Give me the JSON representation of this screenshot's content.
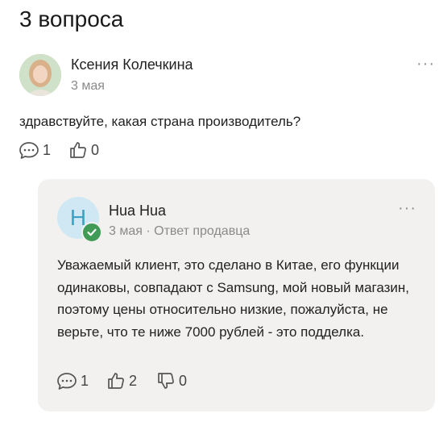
{
  "page": {
    "title": "3 вопроса"
  },
  "question": {
    "author": "Ксения Колечкина",
    "date": "3 мая",
    "text": "здравствуйте,  какая страна производитель?",
    "comments_count": "1",
    "likes_count": "0",
    "more": "···"
  },
  "answer": {
    "avatar_letter": "H",
    "author": "Hua Hua",
    "meta": "3 мая · Ответ продавца",
    "text": "Уважаемый клиент, это сделано в Китае, его функции одинаковы, совпадают с Samsung, мой новый магазин, поэтому цены относительно низкие, пожалуйста, не верьте, что те ниже 7000 рублей - это подделка.",
    "comments_count": "1",
    "likes_count": "2",
    "dislikes_count": "0",
    "more": "···"
  },
  "colors": {
    "verified": "#3f9b56",
    "seller_avatar_bg": "#cfe8f4",
    "card_bg": "#f2f1ef"
  }
}
